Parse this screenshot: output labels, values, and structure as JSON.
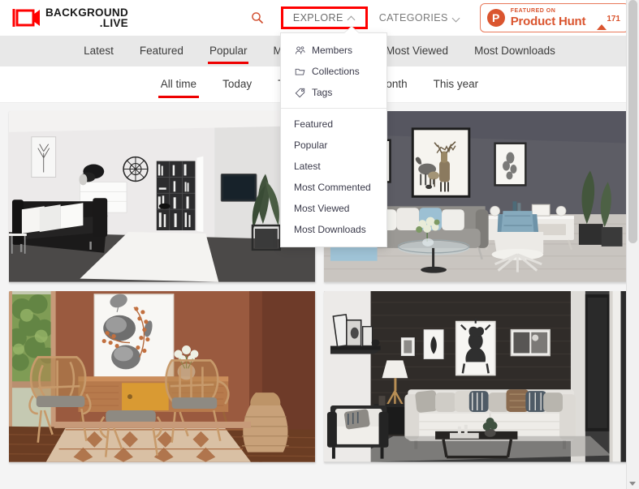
{
  "brand": {
    "name_line1": "BACKGROUND",
    "name_line2": ".LIVE",
    "logo_icon": "camera-logo-icon",
    "color": "#ff0000"
  },
  "header": {
    "search_icon": "search-icon",
    "explore": {
      "label": "EXPLORE",
      "chevron": "chevron-up-icon",
      "active": true,
      "highlight_color": "#ff0000"
    },
    "categories": {
      "label": "CATEGORIES",
      "chevron": "chevron-down-icon",
      "active": false
    },
    "product_hunt": {
      "mark": "P",
      "featured_label": "FEATURED ON",
      "title": "Product Hunt",
      "upvote_icon": "upvote-triangle-icon",
      "upvote_count": "171",
      "color": "#da552f"
    }
  },
  "nav_primary": {
    "active": "Popular",
    "accent": "#ee0000",
    "items": [
      {
        "label": "Latest"
      },
      {
        "label": "Featured"
      },
      {
        "label": "Popular"
      },
      {
        "label": "Most Commented"
      },
      {
        "label": "Most Viewed"
      },
      {
        "label": "Most Downloads"
      }
    ]
  },
  "nav_secondary": {
    "active": "All time",
    "accent": "#ee0000",
    "items": [
      {
        "label": "All time"
      },
      {
        "label": "Today"
      },
      {
        "label": "This week"
      },
      {
        "label": "This month"
      },
      {
        "label": "This year"
      }
    ]
  },
  "explore_dropdown": {
    "open": true,
    "group_one": [
      {
        "label": "Members",
        "icon": "members-icon"
      },
      {
        "label": "Collections",
        "icon": "collections-folder-icon"
      },
      {
        "label": "Tags",
        "icon": "tag-icon"
      }
    ],
    "group_two": [
      {
        "label": "Featured"
      },
      {
        "label": "Popular"
      },
      {
        "label": "Latest"
      },
      {
        "label": "Most Commented"
      },
      {
        "label": "Most Viewed"
      },
      {
        "label": "Most Downloads"
      }
    ]
  },
  "gallery": {
    "cards": [
      {
        "name": "monochrome-living-room",
        "alt": "Monochrome modern living room with black sofa, white rug, tall black bookshelf and potted plant"
      },
      {
        "name": "grey-wall-living-room",
        "alt": "Grey wall living room with deer artwork, grey sofa, blue accent pillows and blue swivel chair"
      },
      {
        "name": "terracotta-rattan-room",
        "alt": "Terracotta coloured room with rattan armchairs, botanical eucalyptus artwork and woven vase"
      },
      {
        "name": "dark-wood-living-room",
        "alt": "Dark wood panelled living room with white sofa, gallery wall of black and white photographs and table lamp"
      }
    ]
  },
  "scrollbar": {
    "up_arrow": "scroll-up-arrow-icon",
    "down_arrow": "scroll-down-arrow-icon"
  }
}
